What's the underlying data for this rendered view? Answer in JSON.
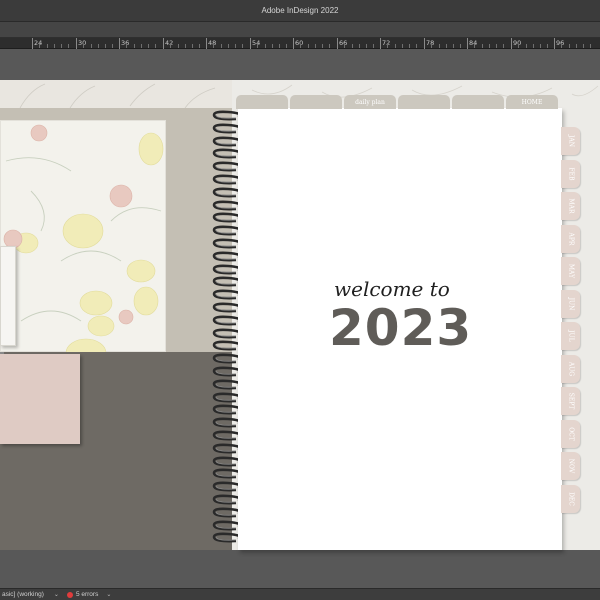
{
  "app": {
    "title": "Adobe InDesign 2022"
  },
  "ruler": {
    "labels": [
      "24",
      "30",
      "36",
      "42",
      "48",
      "54",
      "60",
      "66",
      "72",
      "78",
      "84",
      "90",
      "96"
    ]
  },
  "planner": {
    "welcome": "welcome to",
    "year": "2023",
    "top_tabs": [
      "",
      "",
      "daily plan",
      "",
      "",
      "HOME"
    ],
    "month_tabs": [
      "JAN",
      "FEB",
      "MAR",
      "APR",
      "MAY",
      "JUN",
      "JUL",
      "AUG",
      "SEPT",
      "OCT",
      "NOV",
      "DEC"
    ]
  },
  "statusbar": {
    "profile": "asic] (working)",
    "errors": "5 errors"
  },
  "colors": {
    "tab": "#ccc8bf",
    "month_tab": "#e4d5ce",
    "year_text": "#5f5c58",
    "pocket": "#6e6a64",
    "error_dot": "#e03c3c"
  }
}
